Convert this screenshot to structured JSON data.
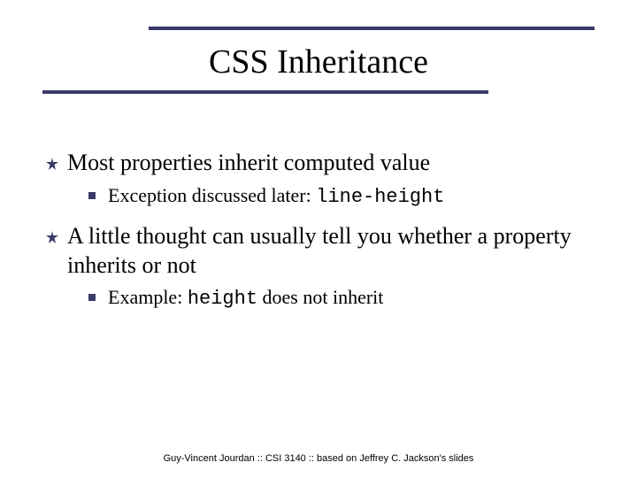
{
  "title": "CSS Inheritance",
  "bullets": [
    {
      "text": "Most properties inherit computed value",
      "sub": [
        {
          "prefix": "Exception discussed later: ",
          "code": "line-height",
          "suffix": ""
        }
      ]
    },
    {
      "text": "A little thought can usually tell you whether a property inherits or not",
      "sub": [
        {
          "prefix": "Example: ",
          "code": "height",
          "suffix": " does not inherit"
        }
      ]
    }
  ],
  "footer": "Guy-Vincent Jourdan :: CSI 3140 :: based on Jeffrey C. Jackson's slides"
}
